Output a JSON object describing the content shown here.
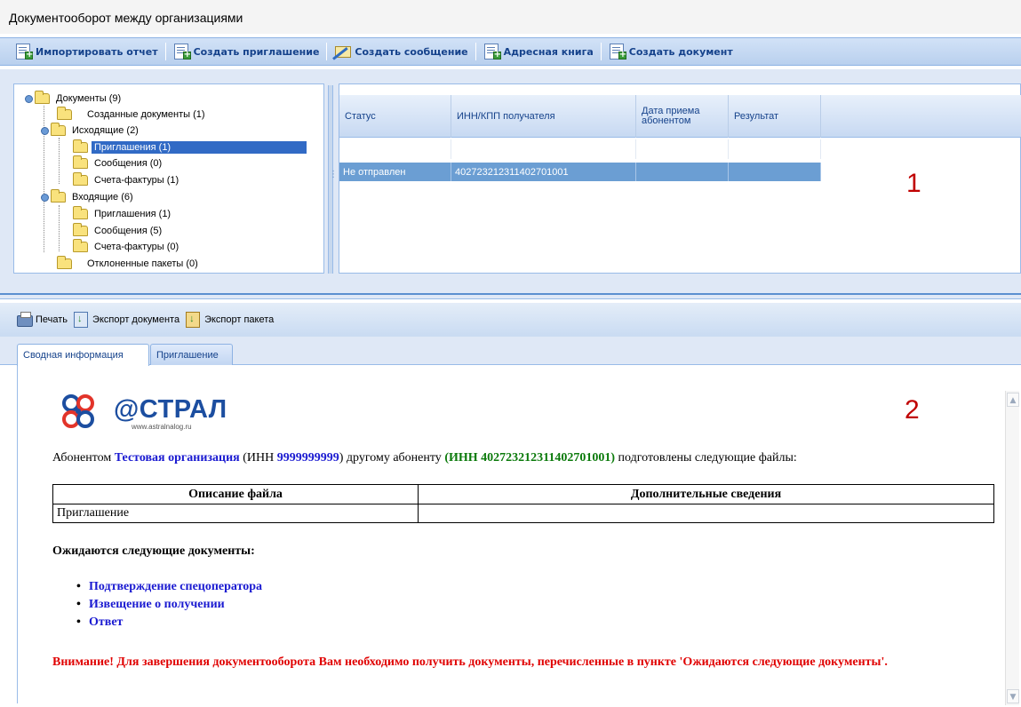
{
  "app": {
    "title": "Документооборот между организациями"
  },
  "toolbar": {
    "import_label": "Импортировать отчет",
    "invite_label": "Создать приглашение",
    "message_label": "Создать сообщение",
    "address_book_label": "Адресная книга",
    "create_doc_label": "Создать документ"
  },
  "tree": {
    "documents": "Документы (9)",
    "created": "Созданные документы (1)",
    "outgoing": "Исходящие (2)",
    "out_invites": "Приглашения (1)",
    "out_messages": "Сообщения (0)",
    "out_invoices": "Счета-фактуры (1)",
    "incoming": "Входящие (6)",
    "in_invites": "Приглашения (1)",
    "in_messages": "Сообщения (5)",
    "in_invoices": "Счета-фактуры (0)",
    "rejected": "Отклоненные пакеты (0)"
  },
  "grid": {
    "columns": [
      "Статус",
      "ИНН/КПП получателя",
      "Дата приема абонентом",
      "Результат"
    ],
    "rows": [
      {
        "status": "Не отправлен",
        "inn": "402723212311402701001",
        "date": "",
        "result": ""
      }
    ]
  },
  "markers": {
    "one": "1",
    "two": "2"
  },
  "toolbar2": {
    "print_label": "Печать",
    "export_doc_label": "Экспорт документа",
    "export_pkg_label": "Экспорт пакета"
  },
  "tabs": {
    "summary": "Сводная информация",
    "invite": "Приглашение"
  },
  "logo": {
    "word": "@СТРАЛ",
    "site": "www.astralnalog.ru"
  },
  "content": {
    "sentence_prefix": "Абонентом ",
    "org_name": "Тестовая организация",
    "inn_open": " (ИНН ",
    "org_inn": "9999999999",
    "inn_close": ") другому абоненту ",
    "recipient": "(ИНН 402723212311402701001)",
    "sentence_suffix": " подготовлены следующие файлы:",
    "table_headers": [
      "Описание файла",
      "Дополнительные сведения"
    ],
    "table_rows": [
      {
        "desc": "Приглашение",
        "extra": ""
      }
    ],
    "expected_heading": "Ожидаются следующие документы:",
    "expected_docs": [
      "Подтверждение спецоператора",
      "Извещение о получении",
      "Ответ"
    ],
    "warning": "Внимание! Для завершения документооборота Вам необходимо получить документы, перечисленные в пункте 'Ожидаются следующие документы'."
  },
  "colors": {
    "accent": "#15428b",
    "link": "#1a1ad1",
    "green": "#0b7a0b",
    "warning": "#e00000",
    "selection": "#316ac5"
  }
}
